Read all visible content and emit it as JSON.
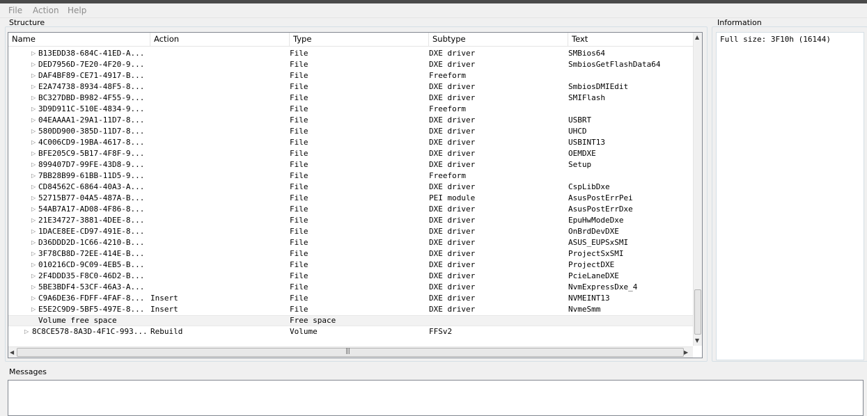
{
  "menu": {
    "file": "File",
    "action": "Action",
    "help": "Help"
  },
  "structure": {
    "label": "Structure",
    "columns": {
      "name": "Name",
      "action": "Action",
      "type": "Type",
      "subtype": "Subtype",
      "text": "Text"
    },
    "rows": [
      {
        "name": "B13EDD38-684C-41ED-A...",
        "action": "",
        "type": "File",
        "subtype": "DXE driver",
        "text": "SMBios64"
      },
      {
        "name": "DED7956D-7E20-4F20-9...",
        "action": "",
        "type": "File",
        "subtype": "DXE driver",
        "text": "SmbiosGetFlashData64"
      },
      {
        "name": "DAF4BF89-CE71-4917-B...",
        "action": "",
        "type": "File",
        "subtype": "Freeform",
        "text": ""
      },
      {
        "name": "E2A74738-8934-48F5-8...",
        "action": "",
        "type": "File",
        "subtype": "DXE driver",
        "text": "SmbiosDMIEdit"
      },
      {
        "name": "BC327DBD-B982-4F55-9...",
        "action": "",
        "type": "File",
        "subtype": "DXE driver",
        "text": "SMIFlash"
      },
      {
        "name": "3D9D911C-510E-4834-9...",
        "action": "",
        "type": "File",
        "subtype": "Freeform",
        "text": ""
      },
      {
        "name": "04EAAAA1-29A1-11D7-8...",
        "action": "",
        "type": "File",
        "subtype": "DXE driver",
        "text": "USBRT"
      },
      {
        "name": "580DD900-385D-11D7-8...",
        "action": "",
        "type": "File",
        "subtype": "DXE driver",
        "text": "UHCD"
      },
      {
        "name": "4C006CD9-19BA-4617-8...",
        "action": "",
        "type": "File",
        "subtype": "DXE driver",
        "text": "USBINT13"
      },
      {
        "name": "BFE205C9-5B17-4F8F-9...",
        "action": "",
        "type": "File",
        "subtype": "DXE driver",
        "text": "OEMDXE"
      },
      {
        "name": "899407D7-99FE-43D8-9...",
        "action": "",
        "type": "File",
        "subtype": "DXE driver",
        "text": "Setup"
      },
      {
        "name": "7BB28B99-61BB-11D5-9...",
        "action": "",
        "type": "File",
        "subtype": "Freeform",
        "text": ""
      },
      {
        "name": "CD84562C-6864-40A3-A...",
        "action": "",
        "type": "File",
        "subtype": "DXE driver",
        "text": "CspLibDxe"
      },
      {
        "name": "52715B77-04A5-487A-B...",
        "action": "",
        "type": "File",
        "subtype": "PEI module",
        "text": "AsusPostErrPei"
      },
      {
        "name": "54AB7A17-AD08-4F86-8...",
        "action": "",
        "type": "File",
        "subtype": "DXE driver",
        "text": "AsusPostErrDxe"
      },
      {
        "name": "21E34727-3881-4DEE-8...",
        "action": "",
        "type": "File",
        "subtype": "DXE driver",
        "text": "EpuHwModeDxe"
      },
      {
        "name": "1DACE8EE-CD97-491E-8...",
        "action": "",
        "type": "File",
        "subtype": "DXE driver",
        "text": "OnBrdDevDXE"
      },
      {
        "name": "D36DDD2D-1C66-4210-B...",
        "action": "",
        "type": "File",
        "subtype": "DXE driver",
        "text": "ASUS_EUPSxSMI"
      },
      {
        "name": "3F78CB8D-72EE-414E-B...",
        "action": "",
        "type": "File",
        "subtype": "DXE driver",
        "text": "ProjectSxSMI"
      },
      {
        "name": "010216CD-9C09-4EB5-B...",
        "action": "",
        "type": "File",
        "subtype": "DXE driver",
        "text": "ProjectDXE"
      },
      {
        "name": "2F4DDD35-F8C0-46D2-B...",
        "action": "",
        "type": "File",
        "subtype": "DXE driver",
        "text": "PcieLaneDXE"
      },
      {
        "name": "5BE3BDF4-53CF-46A3-A...",
        "action": "",
        "type": "File",
        "subtype": "DXE driver",
        "text": "NvmExpressDxe_4"
      },
      {
        "name": "C9A6DE36-FDFF-4FAF-8...",
        "action": "Insert",
        "type": "File",
        "subtype": "DXE driver",
        "text": "NVMEINT13"
      },
      {
        "name": "E5E2C9D9-5BF5-497E-8...",
        "action": "Insert",
        "type": "File",
        "subtype": "DXE driver",
        "text": "NvmeSmm"
      }
    ],
    "free_space_row": {
      "name": "Volume free space",
      "type": "Free space"
    },
    "volume_row": {
      "name": "8C8CE578-8A3D-4F1C-993...",
      "action": "Rebuild",
      "type": "Volume",
      "subtype": "FFSv2"
    }
  },
  "information": {
    "label": "Information",
    "text": "Full size: 3F10h (16144)"
  },
  "messages": {
    "label": "Messages"
  },
  "icons": [
    "expand-arrow-icon",
    "scroll-up-icon",
    "scroll-down-icon",
    "scroll-left-icon",
    "scroll-right-icon",
    "scroll-grip-icon"
  ]
}
